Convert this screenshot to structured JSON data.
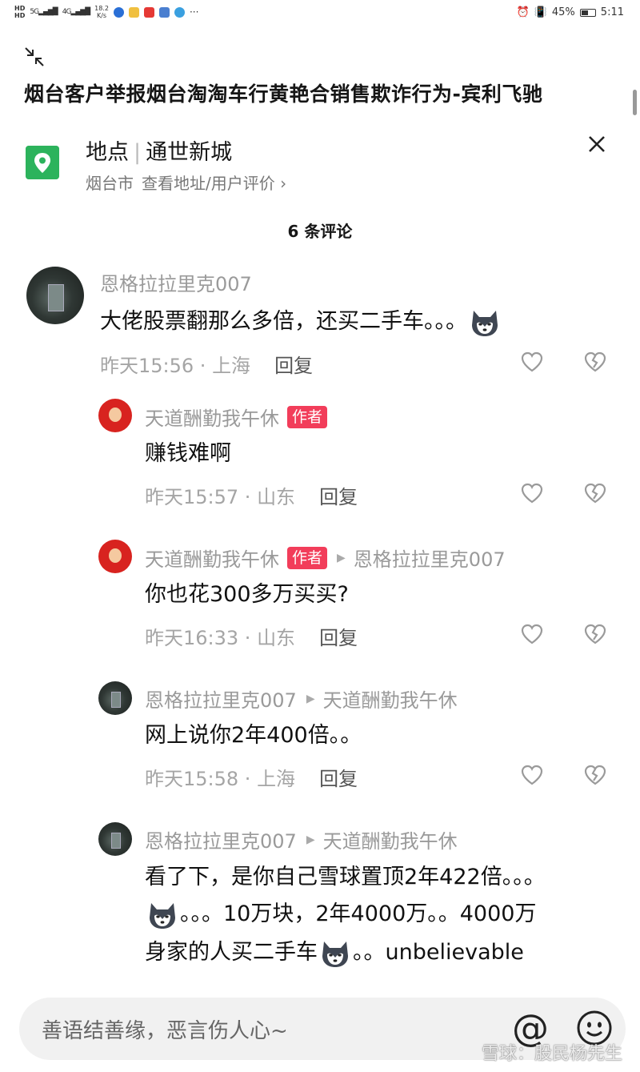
{
  "status_bar": {
    "hd1": "HD",
    "hd2": "HD",
    "sig1": "5G",
    "sig2": "4G",
    "speed": "18.2",
    "speed_unit": "K/s",
    "battery": "45%",
    "battery_level": 0.45,
    "time": "5:11",
    "dots": "···"
  },
  "header": {
    "title": "烟台客户举报烟台淘淘车行黄艳合销售欺诈行为-宾利飞驰"
  },
  "location": {
    "label": "地点",
    "name": "通世新城",
    "city": "烟台市",
    "link": "查看地址/用户评价 ›"
  },
  "comments_header": {
    "count_text": "6 条评论"
  },
  "comments": [
    {
      "author": "恩格拉拉里克007",
      "text": "大佬股票翻那么多倍，还买二手车。。。",
      "time": "昨天15:56",
      "region": "上海",
      "reply_label": "回复"
    },
    {
      "author": "天道酬勤我午休",
      "author_tag": "作者",
      "text": "赚钱难啊",
      "time": "昨天15:57",
      "region": "山东",
      "reply_label": "回复"
    },
    {
      "author": "天道酬勤我午休",
      "author_tag": "作者",
      "reply_to": "恩格拉拉里克007",
      "text": "你也花300多万买买?",
      "time": "昨天16:33",
      "region": "山东",
      "reply_label": "回复"
    },
    {
      "author": "恩格拉拉里克007",
      "reply_to": "天道酬勤我午休",
      "text": "网上说你2年400倍。。",
      "time": "昨天15:58",
      "region": "上海",
      "reply_label": "回复"
    },
    {
      "author": "恩格拉拉里克007",
      "reply_to": "天道酬勤我午休",
      "text_line1": "看了下，是你自己雪球置顶2年422倍。。。",
      "text_line2": "。。。10万块，2年4000万。。4000万",
      "text_line3a": "身家的人买二手车",
      "text_line3b": "。。unbelievable"
    }
  ],
  "input": {
    "placeholder": "善语结善缘，恶言伤人心~",
    "at_symbol": "@"
  },
  "watermark": "雪球：股民杨先生",
  "icons": {
    "collapse": "collapse-icon",
    "location": "location-pin-icon",
    "close": "close-icon",
    "like": "heart-icon",
    "dislike": "broken-heart-icon",
    "emoji": "husky-emoji-icon",
    "smile": "smile-face-icon"
  },
  "colors": {
    "tag": "#f23d5a",
    "location_icon": "#2cb35c",
    "meta_text": "#a5a5a5"
  }
}
